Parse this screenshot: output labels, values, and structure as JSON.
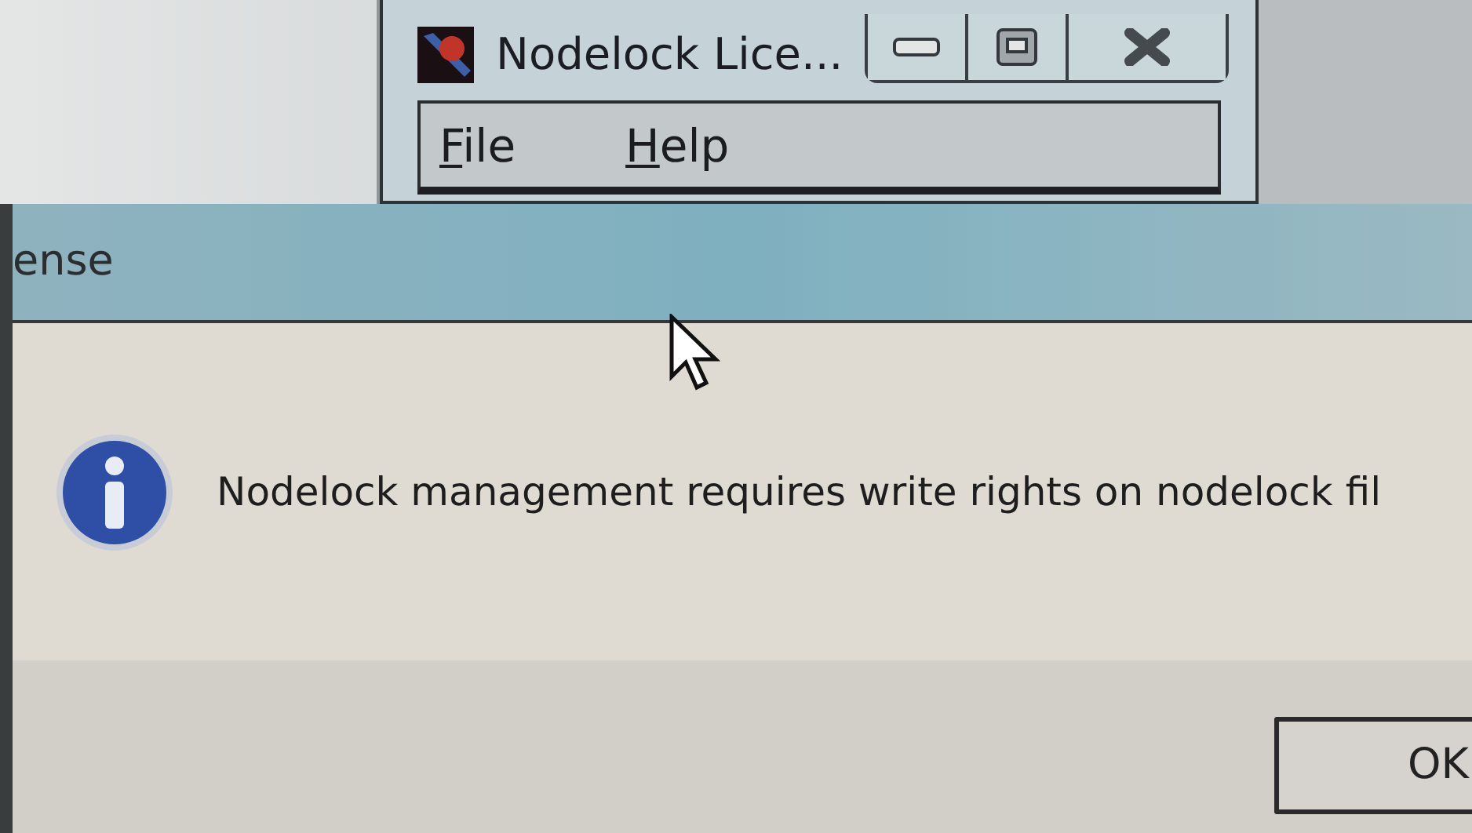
{
  "back_window": {
    "title": "Nodelock Lice...",
    "controls": [
      {
        "kind": "minimize"
      },
      {
        "kind": "maximize"
      },
      {
        "kind": "close"
      }
    ],
    "menu": [
      {
        "label": "File",
        "mnemonic_underlined": true
      },
      {
        "label": "Help",
        "mnemonic_underlined": true
      }
    ]
  },
  "dialog": {
    "title": "ense",
    "message": "Nodelock management requires write rights on nodelock fil",
    "buttons": [
      "OK"
    ]
  }
}
